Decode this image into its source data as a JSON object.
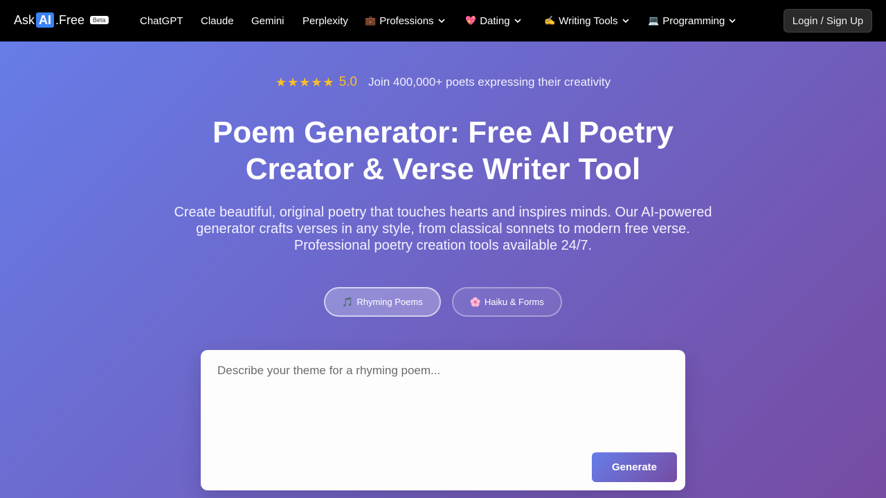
{
  "brand": {
    "prefix": "Ask",
    "ai": "AI",
    "suffix": ".Free",
    "badge": "Beta"
  },
  "nav": {
    "links": [
      {
        "label": "ChatGPT"
      },
      {
        "label": "Claude"
      },
      {
        "label": "Gemini"
      },
      {
        "label": "Perplexity"
      },
      {
        "label": "Professions",
        "emoji": "💼",
        "dropdown": true
      },
      {
        "label": "Dating",
        "emoji": "💖",
        "dropdown": true
      },
      {
        "label": "Writing Tools",
        "emoji": "✍️",
        "dropdown": true
      },
      {
        "label": "Programming",
        "emoji": "💻",
        "dropdown": true
      }
    ],
    "login_label": "Login / Sign Up"
  },
  "hero": {
    "stars": "★★★★★",
    "rating": "5.0",
    "social_proof": "Join 400,000+ poets expressing their creativity",
    "title": "Poem Generator: Free AI Poetry Creator & Verse Writer Tool",
    "subtitle": "Create beautiful, original poetry that touches hearts and inspires minds. Our AI-powered generator crafts verses in any style, from classical sonnets to modern free verse. Professional poetry creation tools available 24/7."
  },
  "tabs": [
    {
      "emoji": "🎵",
      "label": "Rhyming Poems",
      "active": true
    },
    {
      "emoji": "🌸",
      "label": "Haiku & Forms",
      "active": false
    }
  ],
  "form": {
    "placeholder": "Describe your theme for a rhyming poem...",
    "value": "",
    "generate_label": "Generate"
  },
  "colors": {
    "gradient_start": "#667eea",
    "gradient_end": "#764ba2",
    "star": "#fbbf24",
    "brand_ai": "#3b82f6"
  }
}
